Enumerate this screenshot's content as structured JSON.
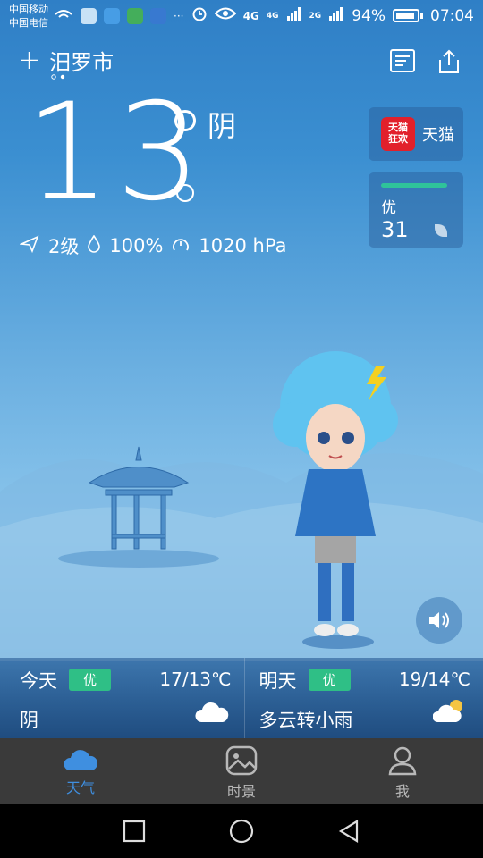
{
  "status_bar": {
    "carrier_1": "中国移动",
    "carrier_2": "中国电信",
    "more": "···",
    "net_1": "4G",
    "net_1_sub": "4G",
    "net_2": "2G",
    "battery": "94%",
    "time": "07:04"
  },
  "header": {
    "add_symbol": "+",
    "city": "汨罗市"
  },
  "current": {
    "temperature": "13",
    "condition": "阴",
    "wind": "2级",
    "humidity": "100%",
    "pressure": "1020 hPa"
  },
  "tmall": {
    "label": "天猫",
    "logo_text_1": "天猫",
    "logo_text_2": "狂欢"
  },
  "aqi": {
    "label": "优",
    "value": "31",
    "color": "#2fc39a"
  },
  "forecast": [
    {
      "day": "今天",
      "aqi": "优",
      "range": "17/13℃",
      "desc": "阴",
      "icon": "cloud-icon"
    },
    {
      "day": "明天",
      "aqi": "优",
      "range": "19/14℃",
      "desc": "多云转小雨",
      "icon": "partly-cloudy-icon"
    }
  ],
  "tabs": [
    {
      "label": "天气",
      "icon": "cloud-icon",
      "active": true
    },
    {
      "label": "时景",
      "icon": "image-icon",
      "active": false
    },
    {
      "label": "我",
      "icon": "person-icon",
      "active": false
    }
  ],
  "colors": {
    "accent": "#3f8fe0",
    "aqi_badge": "#2fbf86",
    "tabbar": "#3a3a3a"
  }
}
